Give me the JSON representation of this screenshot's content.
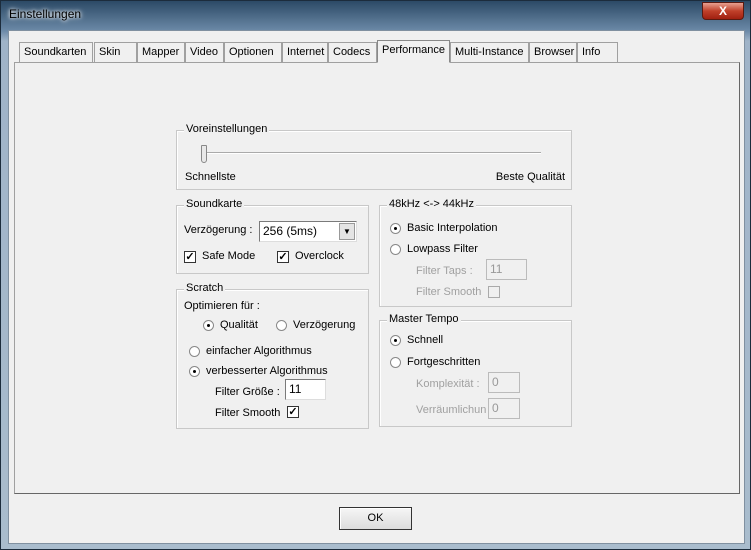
{
  "window": {
    "title": "Einstellungen",
    "close_label": "X"
  },
  "tabs": [
    "Soundkarten",
    "Skin",
    "Mapper",
    "Video",
    "Optionen",
    "Internet",
    "Codecs",
    "Performance",
    "Multi-Instance",
    "Browser",
    "Info"
  ],
  "active_tab": "Performance",
  "presets": {
    "legend": "Voreinstellungen",
    "min_label": "Schnellste",
    "max_label": "Beste Qualität",
    "slider_value": 0
  },
  "soundcard": {
    "legend": "Soundkarte",
    "latency_label": "Verzögerung :",
    "latency_value": "256 (5ms)",
    "safe_mode": "Safe Mode",
    "safe_mode_checked": true,
    "overclock": "Overclock",
    "overclock_checked": true
  },
  "scratch": {
    "legend": "Scratch",
    "optimize_label": "Optimieren für :",
    "quality": "Qualität",
    "latency": "Verzögerung",
    "simple": "einfacher Algorithmus",
    "improved": "verbesserter Algorithmus",
    "filter_size_label": "Filter Größe :",
    "filter_size_value": "11",
    "filter_smooth": "Filter Smooth",
    "filter_smooth_checked": true
  },
  "resample": {
    "legend": "48kHz <-> 44kHz",
    "basic": "Basic Interpolation",
    "lowpass": "Lowpass Filter",
    "taps_label": "Filter Taps :",
    "taps_value": "11",
    "smooth": "Filter Smooth"
  },
  "master_tempo": {
    "legend": "Master Tempo",
    "fast": "Schnell",
    "advanced": "Fortgeschritten",
    "complexity_label": "Komplexität :",
    "complexity_value": "0",
    "spatial_label": "Verräumlichung",
    "spatial_value": "0"
  },
  "ok_label": "OK"
}
